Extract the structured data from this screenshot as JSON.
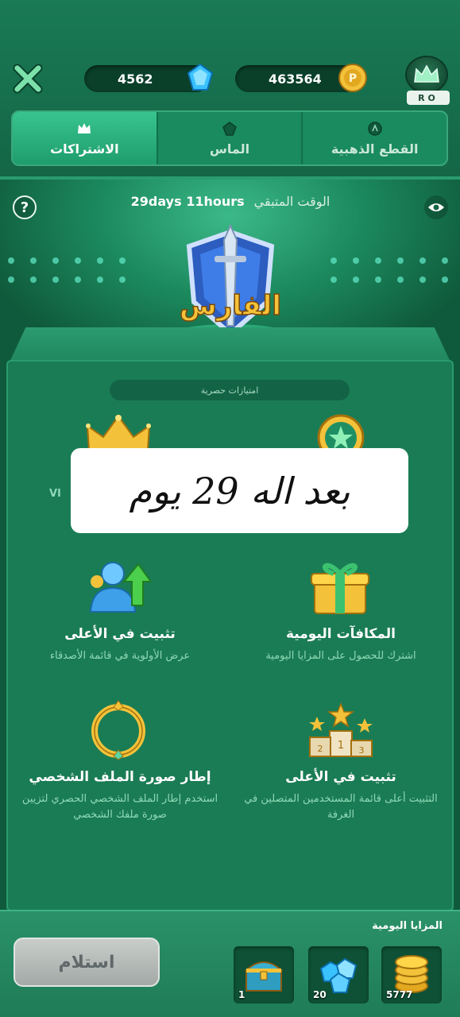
{
  "header": {
    "diamond_count": "4562",
    "gold_count": "463564",
    "avatar_tag": "RO"
  },
  "tabs": [
    {
      "label": "الاشتراكات",
      "icon": "crown-icon",
      "active": true
    },
    {
      "label": "الماس",
      "icon": "diamond-icon",
      "active": false
    },
    {
      "label": "القطع الذهبية",
      "icon": "coin-icon",
      "active": false
    }
  ],
  "subscription": {
    "time_label": "الوقت المتبقي",
    "time_value": "29days 11hours",
    "badge_text": "الفارس"
  },
  "perks": {
    "header": "امتيازات حصرية",
    "overlay_text": "بعد اله 29 يوم",
    "partial_label": "VI",
    "items": [
      {
        "title": "المكافآت اليومية",
        "desc": "اشترك للحصول على المزايا اليومية",
        "icon": "gift-icon"
      },
      {
        "title": "تثبيت في الأعلى",
        "desc": "عرض الأولوية في قائمة الأصدقاء",
        "icon": "user-pin-icon"
      },
      {
        "title": "تثبيت في الأعلى",
        "desc": "التثبيت أعلى قائمة المستخدمين المتصلين في الغرفة",
        "icon": "podium-icon"
      },
      {
        "title": "إطار صورة الملف الشخصي",
        "desc": "استخدم إطار الملف الشخصي الحصري لتزيين صورة ملفك الشخصي",
        "icon": "frame-icon"
      }
    ]
  },
  "daily": {
    "label": "المزايا اليومية",
    "claim_label": "استلام",
    "rewards": [
      {
        "count": "5777",
        "icon": "coins-icon"
      },
      {
        "count": "20",
        "icon": "diamonds-icon"
      },
      {
        "count": "1",
        "icon": "chest-icon"
      }
    ]
  },
  "colors": {
    "background": "#0f5a3c",
    "accent": "#38c48e"
  }
}
